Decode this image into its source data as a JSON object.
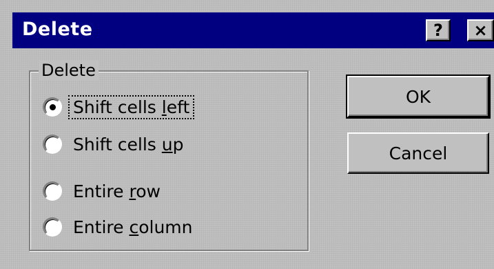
{
  "window": {
    "title": "Delete",
    "help_button": "?",
    "close_button": "×"
  },
  "group": {
    "label": "Delete",
    "options": [
      {
        "pre": "Shift cells ",
        "mn": "l",
        "post": "eft",
        "selected": true
      },
      {
        "pre": "Shift cells ",
        "mn": "u",
        "post": "p",
        "selected": false
      },
      {
        "pre": "Entire ",
        "mn": "r",
        "post": "ow",
        "selected": false
      },
      {
        "pre": "Entire ",
        "mn": "c",
        "post": "olumn",
        "selected": false
      }
    ]
  },
  "buttons": {
    "ok": "OK",
    "cancel": "Cancel"
  }
}
